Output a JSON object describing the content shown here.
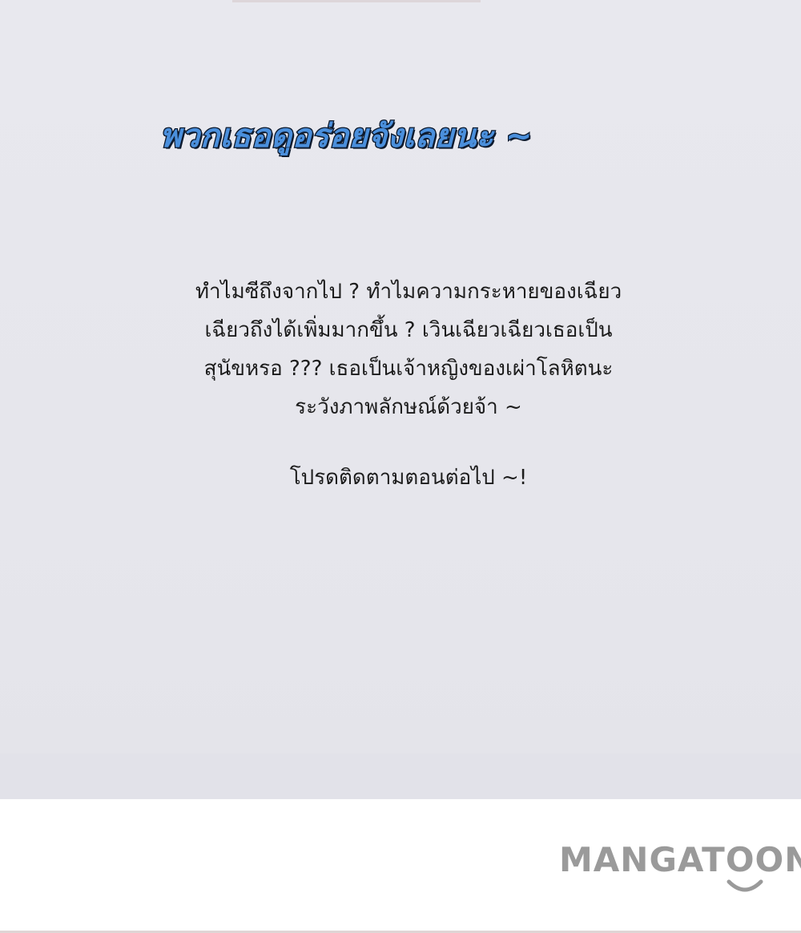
{
  "panel": {
    "title": "พวกเธอดูอร่อยจังเลยนะ ~",
    "body_lines": [
      "ทำไมซีถึงจากไป ? ทำไมความกระหายของเฉียว",
      "เฉียวถึงได้เพิ่มมากขึ้น ? เวินเฉียวเฉียวเธอเป็น",
      "สุนัขหรอ ??? เธอเป็นเจ้าหญิงของเผ่าโลหิตนะ",
      "ระวังภาพลักษณ์ด้วยจ้า ~"
    ],
    "follow_text": "โปรดติดตามตอนต่อไป ~!"
  },
  "watermark": {
    "text": "MANGATOON",
    "color": "#9a9a9a",
    "icon": "smile-icon"
  },
  "colors": {
    "panel_background": "#e7e7ed",
    "title_fill": "#4a8fdc",
    "title_outline": "#0d1a2e",
    "body_text": "#1c1c1c"
  }
}
